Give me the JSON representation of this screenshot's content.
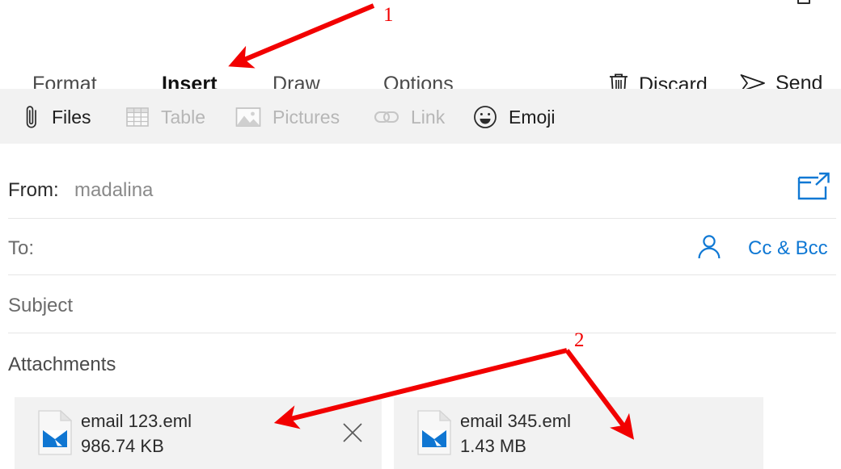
{
  "window": {
    "top_icon": "window-restore-icon"
  },
  "tabs": [
    {
      "label": "Format",
      "active": false,
      "name": "tab-format"
    },
    {
      "label": "Insert",
      "active": true,
      "name": "tab-insert"
    },
    {
      "label": "Draw",
      "active": false,
      "name": "tab-draw"
    },
    {
      "label": "Options",
      "active": false,
      "name": "tab-options"
    }
  ],
  "commands": [
    {
      "label": "Discard",
      "icon": "trash-icon"
    },
    {
      "label": "Send",
      "icon": "send-icon"
    }
  ],
  "ribbon": [
    {
      "label": "Files",
      "icon": "paperclip-icon",
      "enabled": true
    },
    {
      "label": "Table",
      "icon": "table-icon",
      "enabled": false
    },
    {
      "label": "Pictures",
      "icon": "picture-icon",
      "enabled": false
    },
    {
      "label": "Link",
      "icon": "link-icon",
      "enabled": false
    },
    {
      "label": "Emoji",
      "icon": "smiley-icon",
      "enabled": true
    }
  ],
  "fields": {
    "from_label": "From:",
    "from_value": "madalina",
    "to_label": "To:",
    "to_value": "",
    "subject_placeholder": "Subject",
    "subject_value": "",
    "cc_bcc_label": "Cc & Bcc",
    "person_icon": "person-icon",
    "popout_icon": "pop-out-icon"
  },
  "attachments": {
    "heading": "Attachments",
    "items": [
      {
        "name": "email 123.eml",
        "size": "986.74 KB",
        "icon": "eml-file-icon",
        "close": "close-icon"
      },
      {
        "name": "email 345.eml",
        "size": "1.43 MB",
        "icon": "eml-file-icon",
        "close": "close-icon"
      }
    ]
  },
  "annotations": [
    {
      "label": "1"
    },
    {
      "label": "2"
    }
  ],
  "colors": {
    "accent_blue": "#0078d4",
    "link_blue": "#0f78d4",
    "annotation_red": "#f20000",
    "ribbon_bg": "#f2f2f2",
    "card_bg": "#f2f2f2",
    "divider": "#e6e6e6"
  }
}
